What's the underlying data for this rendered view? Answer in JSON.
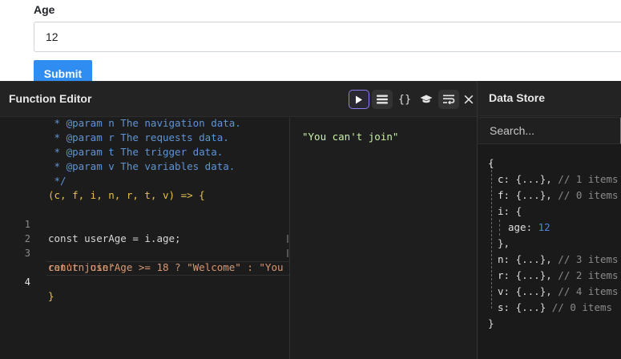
{
  "form": {
    "age_label": "Age",
    "age_value": "12",
    "submit_label": "Submit"
  },
  "editor": {
    "title": "Function Editor",
    "toolbar": {
      "run_icon": "play-icon",
      "list_icon": "list-icon",
      "braces_label": "{}",
      "learn_icon": "graduation-cap-icon",
      "wrap_icon": "wrap-icon",
      "close_label": "×"
    },
    "code_lines": [
      {
        "num": "",
        "text": " * @param n The navigation data."
      },
      {
        "num": "",
        "text": " * @param r The requests data."
      },
      {
        "num": "",
        "text": " * @param t The trigger data."
      },
      {
        "num": "",
        "text": " * @param v The variables data."
      },
      {
        "num": "",
        "text": " */"
      },
      {
        "num": "",
        "text": "(c, f, i, n, r, t, v) => {"
      },
      {
        "num": "1",
        "text": "const userAge = i.age;"
      },
      {
        "num": "2",
        "text": ""
      },
      {
        "num": "3",
        "text": "return userAge >= 18 ? \"Welcome\" : \"You"
      },
      {
        "num": "",
        "text": "can't join\""
      },
      {
        "num": "4",
        "text": ""
      },
      {
        "num": "",
        "text": "}"
      }
    ],
    "output": "\"You can't join\""
  },
  "store": {
    "title": "Data Store",
    "search_placeholder": "Search...",
    "open_brace": "{",
    "close_brace": "}",
    "entries": [
      {
        "key": "c",
        "value": "{...}",
        "comment": "// 1 items"
      },
      {
        "key": "f",
        "value": "{...}",
        "comment": "// 0 items"
      },
      {
        "key": "i",
        "value": "{"
      },
      {
        "key": "age",
        "value": "12"
      },
      {
        "key": "",
        "value": "},"
      },
      {
        "key": "n",
        "value": "{...}",
        "comment": "// 3 items"
      },
      {
        "key": "r",
        "value": "{...}",
        "comment": "// 2 items"
      },
      {
        "key": "v",
        "value": "{...}",
        "comment": "// 4 items"
      },
      {
        "key": "s",
        "value": "{...}",
        "comment": "// 0 items"
      }
    ]
  },
  "colors": {
    "submit_bg": "#2f8cf0",
    "editor_bg": "#1e1e1e",
    "comment": "#5f94d6",
    "string": "#d99873",
    "output": "#c8f0a6",
    "number": "#4f86d9",
    "active_border": "#8b7ff0"
  }
}
